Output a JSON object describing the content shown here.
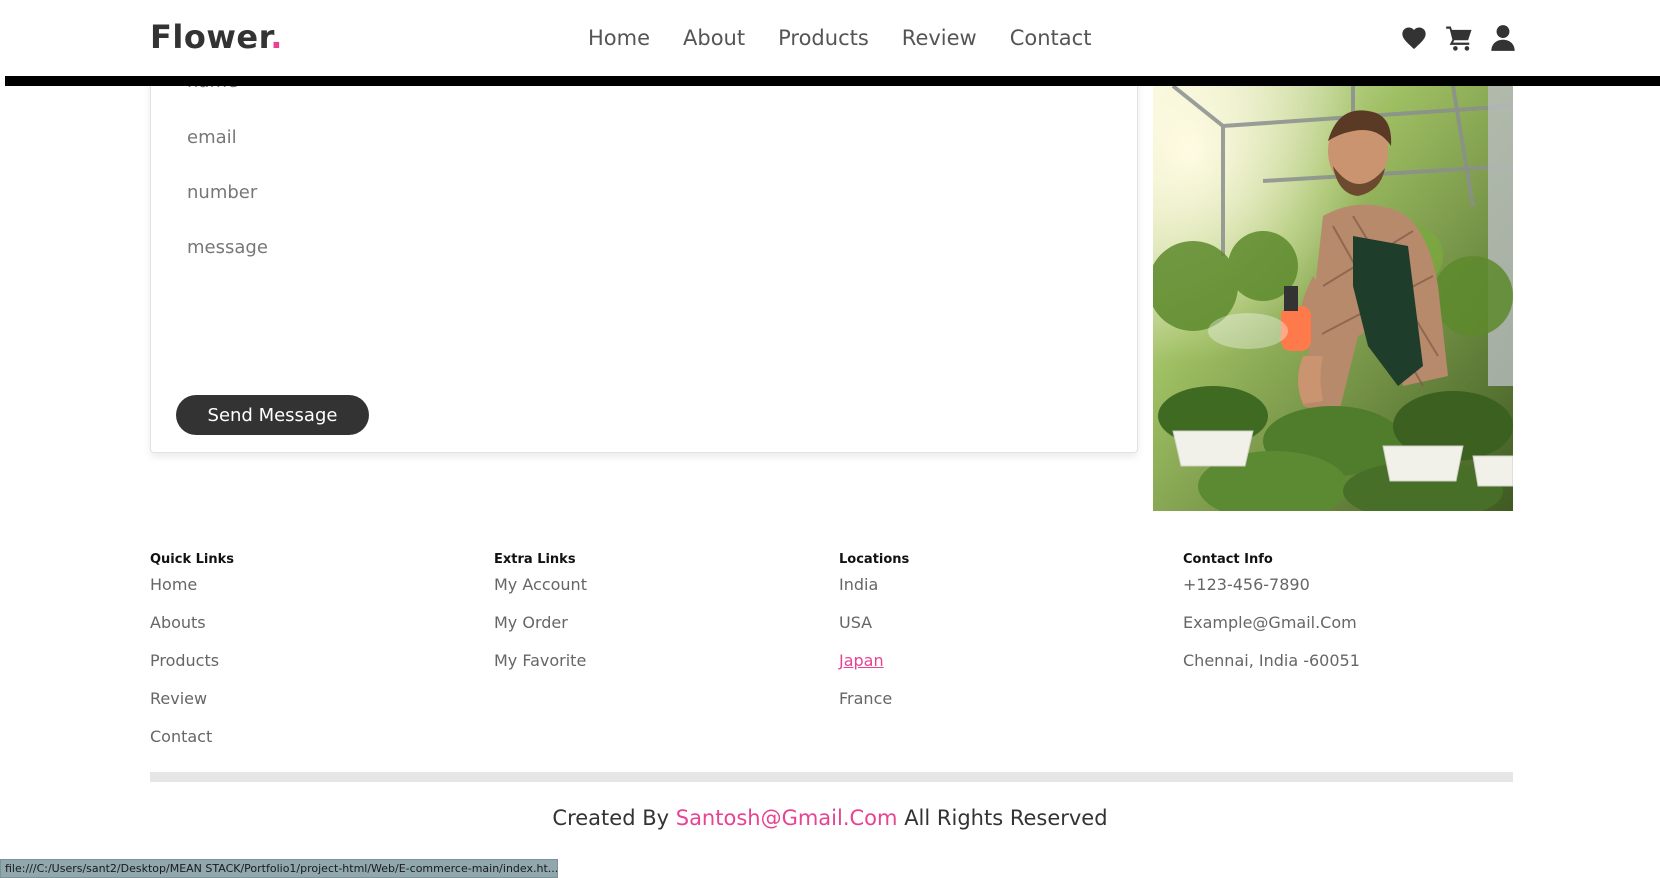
{
  "header": {
    "logo_text": "Flower",
    "logo_dot": ".",
    "nav": [
      "Home",
      "About",
      "Products",
      "Review",
      "Contact"
    ],
    "icons": [
      "heart-icon",
      "cart-icon",
      "user-icon"
    ]
  },
  "form": {
    "name_placeholder": "name",
    "email_placeholder": "email",
    "number_placeholder": "number",
    "message_placeholder": "message",
    "send_label": "Send Message"
  },
  "footer": {
    "quick_links": {
      "title": "Quick Links",
      "items": [
        "Home",
        "Abouts",
        "Products",
        "Review",
        "Contact"
      ]
    },
    "extra_links": {
      "title": "Extra Links",
      "items": [
        "My Account",
        "My Order",
        "My Favorite"
      ]
    },
    "locations": {
      "title": "Locations",
      "items": [
        "India",
        "USA",
        "Japan",
        "France"
      ]
    },
    "contact_info": {
      "title": "Contact Info",
      "items": [
        "+123-456-7890",
        "Example@Gmail.Com",
        "Chennai, India -60051"
      ]
    },
    "credit_prefix": "Created By",
    "credit_brand": "Santosh@Gmail.Com",
    "credit_suffix": "All Rights Reserved"
  },
  "status_url": "file:///C:/Users/sant2/Desktop/MEAN STACK/Portfolio1/project-html/Web/E-commerce-main/index.ht...",
  "colors": {
    "accent": "#e84393",
    "dark": "#333333",
    "header_bar": "#000000"
  }
}
